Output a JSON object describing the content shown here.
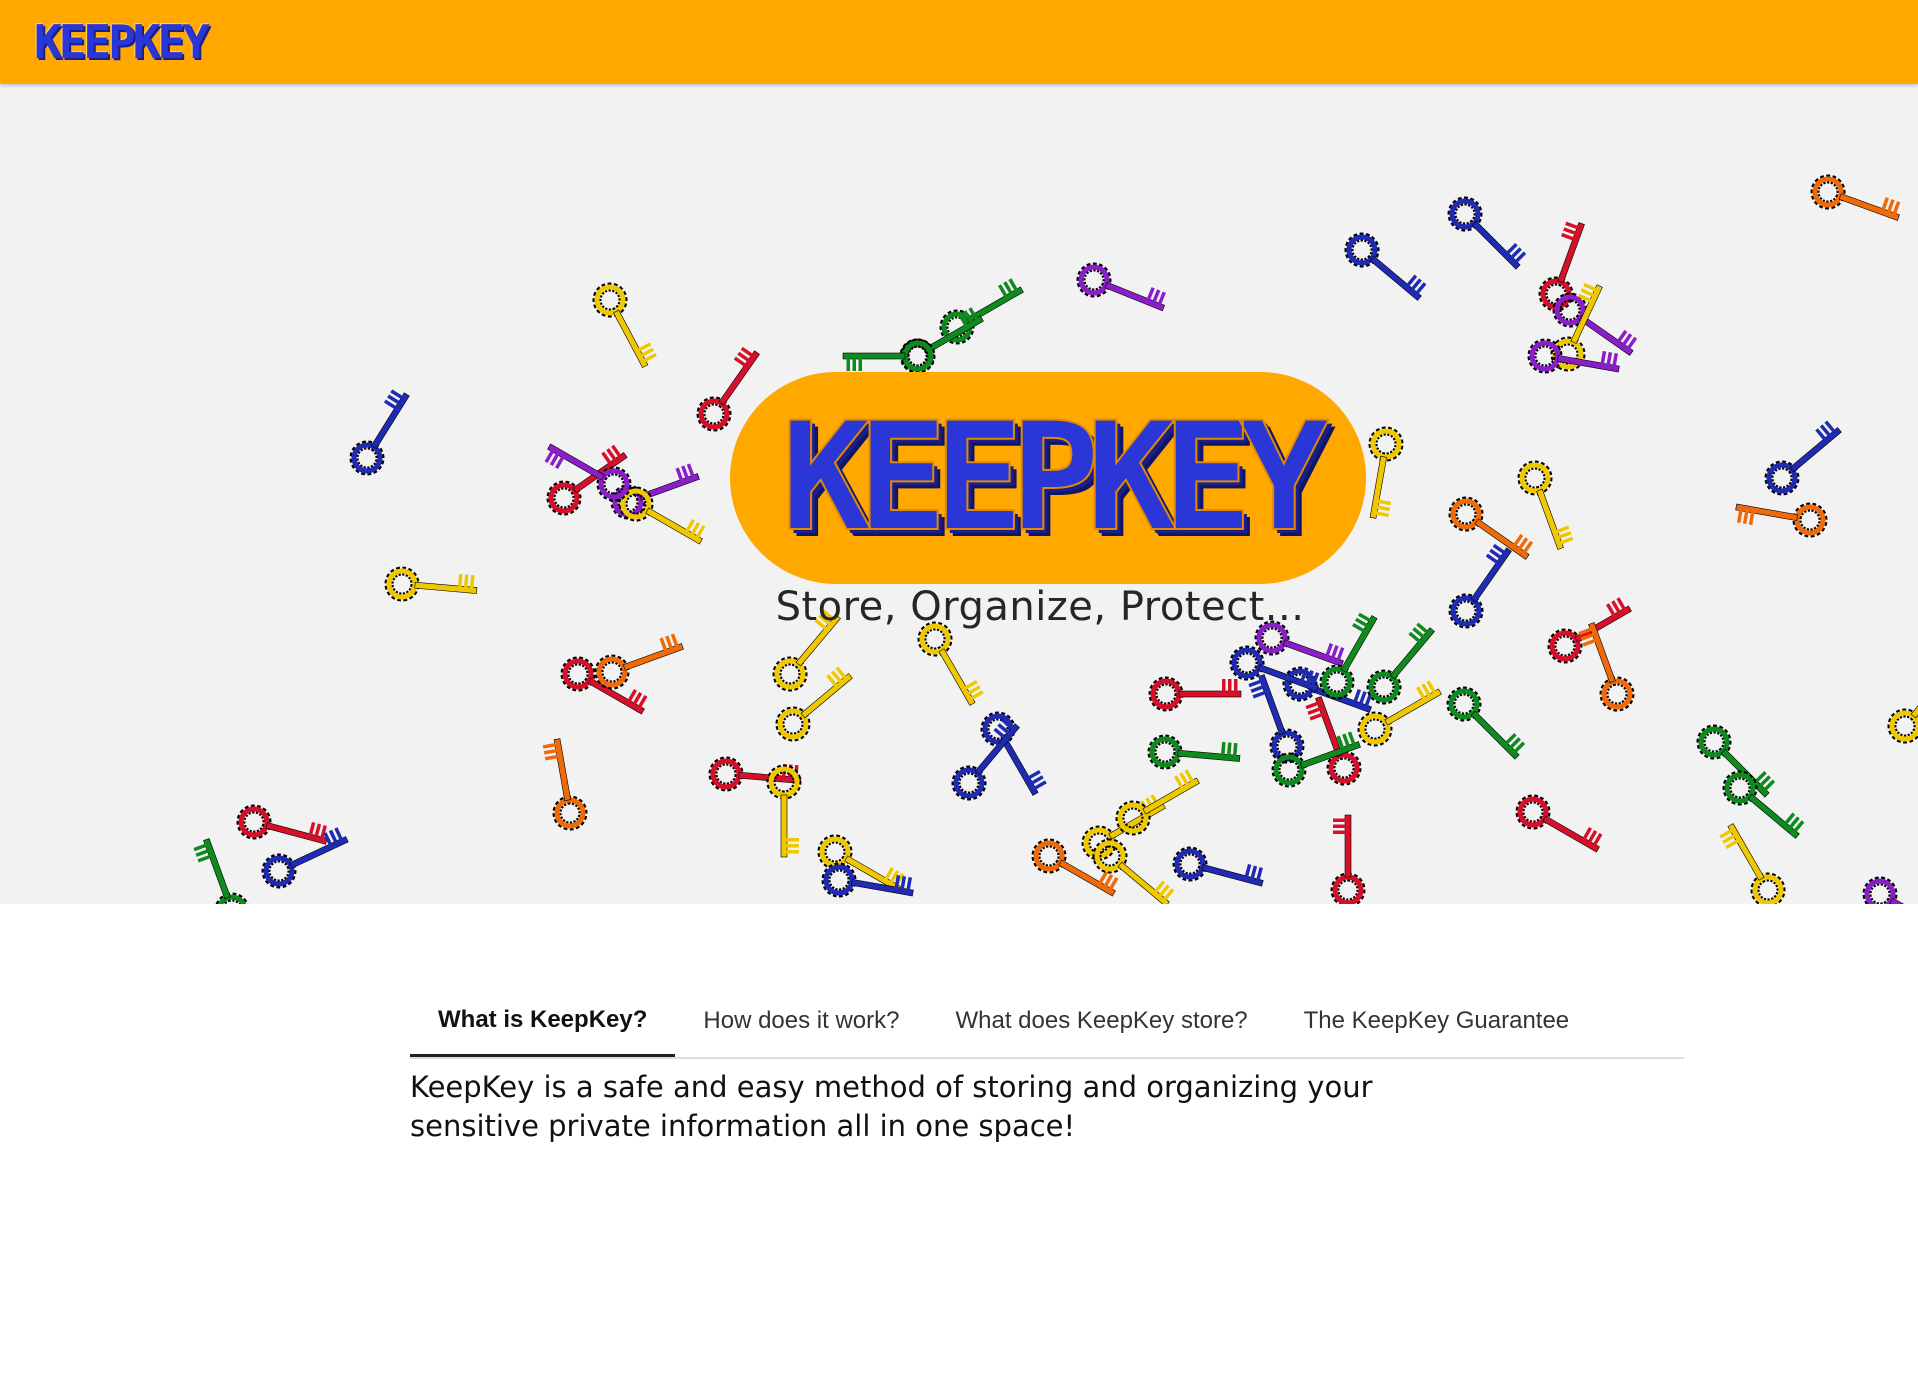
{
  "header": {
    "logo_text": "KEEPKEY",
    "background_color": "#ffa800",
    "logo_color": "#2a36d6"
  },
  "hero": {
    "title": "KEEPKEY",
    "tagline": "Store, Organize, Protect...",
    "background_color": "#f2f2f2",
    "pill_color": "#ffa800",
    "key_colors": [
      "#d7102a",
      "#1f2bb3",
      "#0e8a1e",
      "#f0c800",
      "#f06a0a",
      "#8a1ec8"
    ]
  },
  "tabs": [
    {
      "label": "What is KeepKey?",
      "active": true
    },
    {
      "label": "How does it work?",
      "active": false
    },
    {
      "label": "What does KeepKey store?",
      "active": false
    },
    {
      "label": "The KeepKey Guarantee",
      "active": false
    }
  ],
  "content": {
    "text": "KeepKey is a safe and easy method of storing and organizing your sensitive private information all in one space!"
  }
}
